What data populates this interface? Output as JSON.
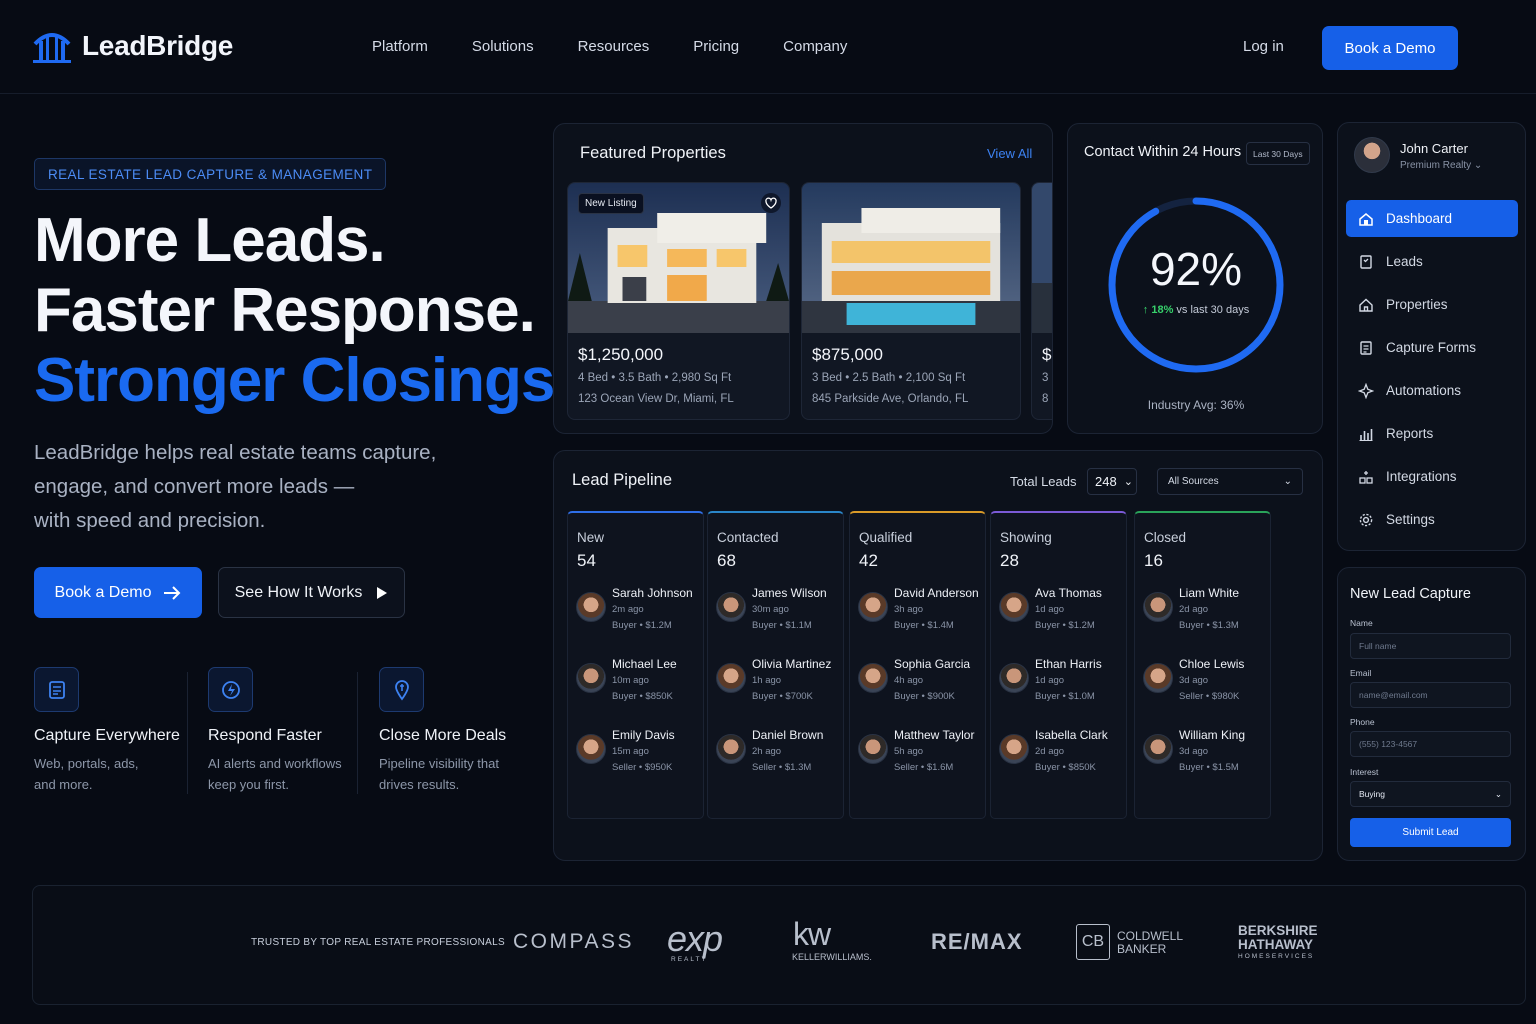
{
  "nav": {
    "brand": "LeadBridge",
    "links": [
      "Platform",
      "Solutions",
      "Resources",
      "Pricing",
      "Company"
    ],
    "login": "Log in",
    "cta": "Book a Demo"
  },
  "hero": {
    "tag": "REAL ESTATE LEAD CAPTURE & MANAGEMENT",
    "headline_1": "More Leads.",
    "headline_2": "Faster Response.",
    "headline_3": "Stronger Closings.",
    "subtitle_1": "LeadBridge helps real estate teams capture,",
    "subtitle_2": "engage, and convert more leads —",
    "subtitle_3": "with speed and precision.",
    "cta_primary": "Book a Demo",
    "cta_secondary": "See How It Works",
    "features": [
      {
        "title": "Capture Everywhere",
        "desc_1": "Web, portals, ads,",
        "desc_2": "and more.",
        "icon": "form-icon"
      },
      {
        "title": "Respond Faster",
        "desc_1": "AI alerts and workflows",
        "desc_2": "keep you first.",
        "icon": "alert-icon"
      },
      {
        "title": "Close More Deals",
        "desc_1": "Pipeline visibility that",
        "desc_2": "drives results.",
        "icon": "deal-icon"
      }
    ]
  },
  "featured": {
    "title": "Featured Properties",
    "view_all": "View All",
    "properties": [
      {
        "badge": "New Listing",
        "price": "$1,250,000",
        "meta": "4 Bed  •  3.5 Bath  •  2,980 Sq Ft",
        "address": "123 Ocean View Dr, Miami, FL"
      },
      {
        "badge": "",
        "price": "$875,000",
        "meta": "3 Bed  •  2.5 Bath  •  2,100 Sq Ft",
        "address": "845 Parkside Ave, Orlando, FL"
      },
      {
        "badge": "",
        "price": "$",
        "meta": "3",
        "address": "8"
      }
    ]
  },
  "contact": {
    "title": "Contact Within 24 Hours",
    "period": "Last 30 Days",
    "percent_value": 92,
    "percent_label": "92%",
    "delta": "18%",
    "delta_suffix": " vs last 30 days",
    "industry": "Industry Avg: 36%"
  },
  "sidebar": {
    "user_name": "John Carter",
    "user_company": "Premium Realty",
    "items": [
      {
        "label": "Dashboard",
        "icon": "home-icon",
        "active": true
      },
      {
        "label": "Leads",
        "icon": "leads-icon"
      },
      {
        "label": "Properties",
        "icon": "house-icon"
      },
      {
        "label": "Capture Forms",
        "icon": "form-icon"
      },
      {
        "label": "Automations",
        "icon": "automation-icon"
      },
      {
        "label": "Reports",
        "icon": "bar-chart-icon"
      },
      {
        "label": "Integrations",
        "icon": "integration-icon"
      },
      {
        "label": "Settings",
        "icon": "gear-icon"
      }
    ]
  },
  "capture": {
    "title": "New Lead Capture",
    "name_label": "Name",
    "name_placeholder": "Full name",
    "email_label": "Email",
    "email_placeholder": "name@email.com",
    "phone_label": "Phone",
    "phone_placeholder": "(555) 123-4567",
    "interest_label": "Interest",
    "interest_value": "Buying",
    "submit": "Submit Lead"
  },
  "pipeline": {
    "title": "Lead Pipeline",
    "total_label": "Total Leads",
    "total_value": "248",
    "source_value": "All Sources",
    "columns": [
      {
        "name": "New",
        "count": "54",
        "color": "#2f6fe8",
        "leads": [
          {
            "name": "Sarah Johnson",
            "time": "2m ago",
            "deal": "Buyer • $1.2M",
            "avatar": "female"
          },
          {
            "name": "Michael Lee",
            "time": "10m ago",
            "deal": "Buyer • $850K",
            "avatar": "male"
          },
          {
            "name": "Emily Davis",
            "time": "15m ago",
            "deal": "Seller • $950K",
            "avatar": "female"
          }
        ]
      },
      {
        "name": "Contacted",
        "count": "68",
        "color": "#2a86c9",
        "leads": [
          {
            "name": "James Wilson",
            "time": "30m ago",
            "deal": "Buyer • $1.1M",
            "avatar": "male"
          },
          {
            "name": "Olivia Martinez",
            "time": "1h ago",
            "deal": "Buyer • $700K",
            "avatar": "female"
          },
          {
            "name": "Daniel Brown",
            "time": "2h ago",
            "deal": "Seller • $1.3M",
            "avatar": "male"
          }
        ]
      },
      {
        "name": "Qualified",
        "count": "42",
        "color": "#d99a28",
        "leads": [
          {
            "name": "David Anderson",
            "time": "3h ago",
            "deal": "Buyer • $1.4M",
            "avatar": "female"
          },
          {
            "name": "Sophia Garcia",
            "time": "4h ago",
            "deal": "Buyer • $900K",
            "avatar": "female"
          },
          {
            "name": "Matthew Taylor",
            "time": "5h ago",
            "deal": "Seller • $1.6M",
            "avatar": "male"
          }
        ]
      },
      {
        "name": "Showing",
        "count": "28",
        "color": "#7b5ad6",
        "leads": [
          {
            "name": "Ava Thomas",
            "time": "1d ago",
            "deal": "Buyer • $1.2M",
            "avatar": "female"
          },
          {
            "name": "Ethan Harris",
            "time": "1d ago",
            "deal": "Buyer • $1.0M",
            "avatar": "male"
          },
          {
            "name": "Isabella Clark",
            "time": "2d ago",
            "deal": "Buyer • $850K",
            "avatar": "female"
          }
        ]
      },
      {
        "name": "Closed",
        "count": "16",
        "color": "#2aa35a",
        "leads": [
          {
            "name": "Liam White",
            "time": "2d ago",
            "deal": "Buyer • $1.3M",
            "avatar": "male"
          },
          {
            "name": "Chloe Lewis",
            "time": "3d ago",
            "deal": "Seller • $980K",
            "avatar": "female"
          },
          {
            "name": "William King",
            "time": "3d ago",
            "deal": "Buyer • $1.5M",
            "avatar": "male"
          }
        ]
      }
    ]
  },
  "trusted": {
    "label": "TRUSTED BY TOP REAL ESTATE PROFESSIONALS",
    "brands": {
      "compass": "COMPASS",
      "exp": "exp",
      "exp_sub": "REALTY",
      "kw": "kw",
      "kw_sub": "KELLERWILLIAMS.",
      "remax": "RE/MAX",
      "coldwell_1": "COLDWELL",
      "coldwell_2": "BANKER",
      "berkshire_1": "BERKSHIRE",
      "berkshire_2": "HATHAWAY",
      "berkshire_3": "HOMESERVICES"
    }
  }
}
